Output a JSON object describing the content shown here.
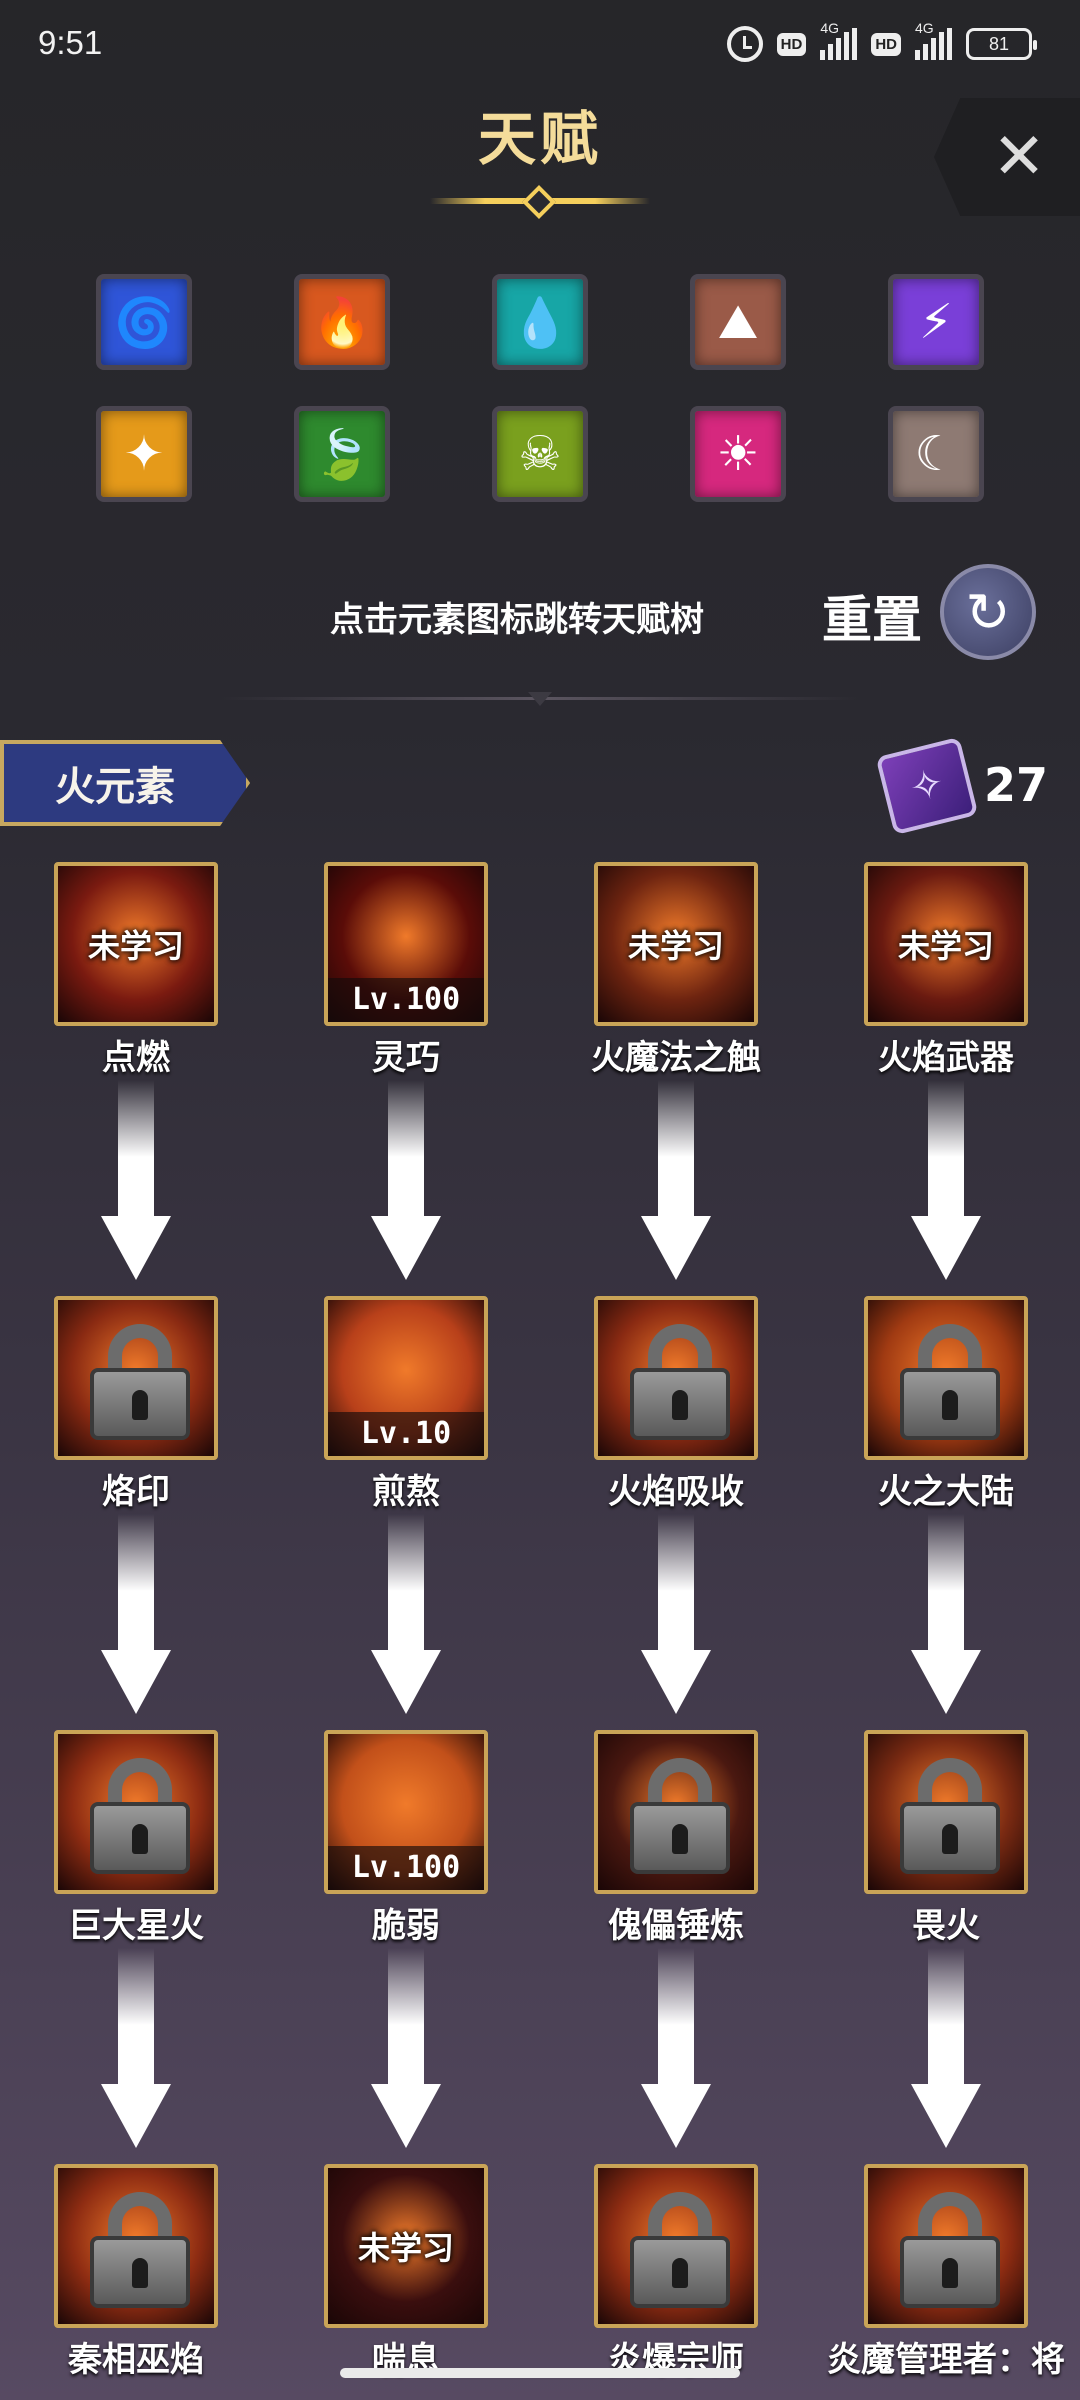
{
  "status": {
    "time": "9:51",
    "hd": "HD",
    "net": "4G",
    "battery": "81"
  },
  "title": "天赋",
  "elements": [
    {
      "name": "tornado-icon",
      "glyph": "🌀",
      "color": "#2f55d8"
    },
    {
      "name": "fire-icon",
      "glyph": "🔥",
      "color": "#d8581f"
    },
    {
      "name": "water-drop-icon",
      "glyph": "💧",
      "color": "#17a6a6"
    },
    {
      "name": "earth-icon",
      "glyph": "⛰",
      "color": "#9a5a48"
    },
    {
      "name": "lightning-icon",
      "glyph": "⚡",
      "color": "#7a3fd8"
    },
    {
      "name": "light-icon",
      "glyph": "✦",
      "color": "#e59a1a"
    },
    {
      "name": "leaf-icon",
      "glyph": "🍃",
      "color": "#2e8a2e"
    },
    {
      "name": "skull-icon",
      "glyph": "☠",
      "color": "#7aa01e"
    },
    {
      "name": "sun-icon",
      "glyph": "☀",
      "color": "#d6287e"
    },
    {
      "name": "moon-icon",
      "glyph": "☾",
      "color": "#8e7a73"
    }
  ],
  "hint": "点击元素图标跳转天赋树",
  "reset_label": "重置",
  "section": {
    "name": "火元素",
    "scroll_count": "27"
  },
  "skills": [
    {
      "name": "点燃",
      "overlay": "未学习",
      "level": "",
      "locked": false,
      "bg": "#7a1a10"
    },
    {
      "name": "灵巧",
      "overlay": "",
      "level": "Lv.100",
      "locked": false,
      "bg": "#5a0c08"
    },
    {
      "name": "火魔法之触",
      "overlay": "未学习",
      "level": "",
      "locked": false,
      "bg": "#6e2410"
    },
    {
      "name": "火焰武器",
      "overlay": "未学习",
      "level": "",
      "locked": false,
      "bg": "#6a1a10"
    },
    {
      "name": "烙印",
      "overlay": "",
      "level": "",
      "locked": true,
      "bg": "#8a2a12"
    },
    {
      "name": "煎熬",
      "overlay": "",
      "level": "Lv.10",
      "locked": false,
      "bg": "#b8401a"
    },
    {
      "name": "火焰吸收",
      "overlay": "",
      "level": "",
      "locked": true,
      "bg": "#8a2a12"
    },
    {
      "name": "火之大陆",
      "overlay": "",
      "level": "",
      "locked": true,
      "bg": "#a03a12"
    },
    {
      "name": "巨大星火",
      "overlay": "",
      "level": "",
      "locked": true,
      "bg": "#8e2c12"
    },
    {
      "name": "脆弱",
      "overlay": "",
      "level": "Lv.100",
      "locked": false,
      "bg": "#c2501a"
    },
    {
      "name": "傀儡锤炼",
      "overlay": "",
      "level": "",
      "locked": true,
      "bg": "#4a1810"
    },
    {
      "name": "畏火",
      "overlay": "",
      "level": "",
      "locked": true,
      "bg": "#7a2a12"
    },
    {
      "name": "秦相巫焰",
      "overlay": "",
      "level": "",
      "locked": true,
      "bg": "#8e2c12"
    },
    {
      "name": "喘息",
      "overlay": "未学习",
      "level": "",
      "locked": false,
      "bg": "#3a0e0e"
    },
    {
      "name": "炎爆宗师",
      "overlay": "",
      "level": "",
      "locked": true,
      "bg": "#8e2c12"
    },
    {
      "name": "炎魔管理者：将",
      "overlay": "",
      "level": "",
      "locked": true,
      "bg": "#8e2c12"
    }
  ]
}
